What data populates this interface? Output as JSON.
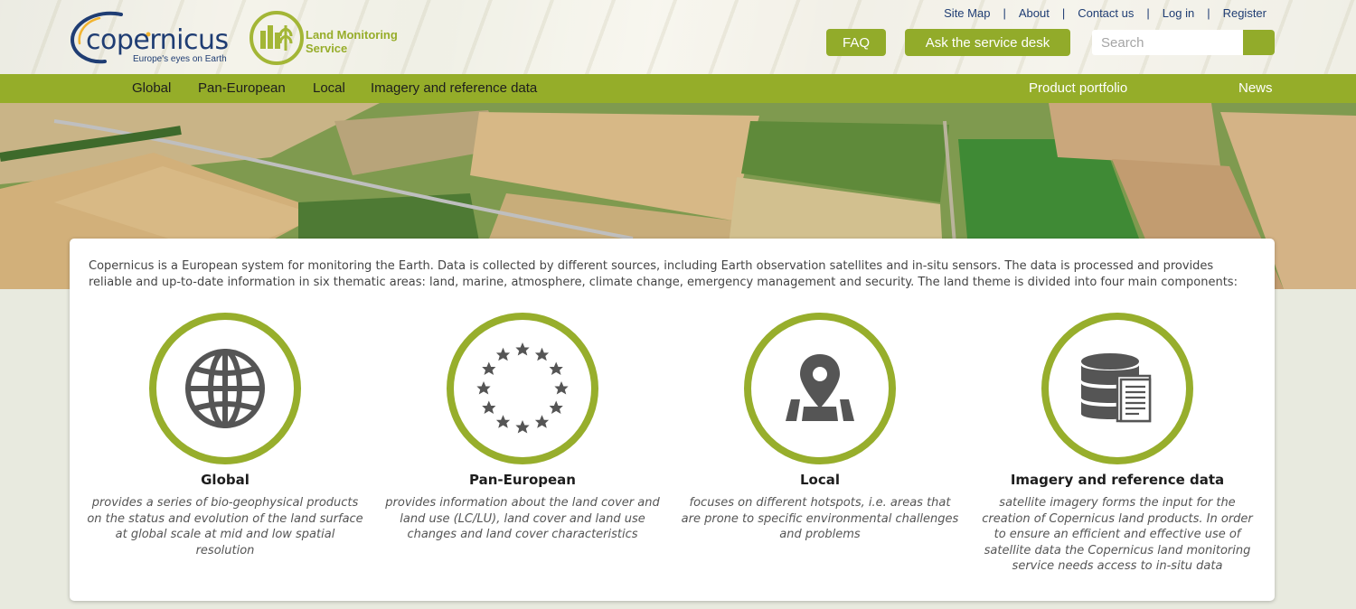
{
  "header": {
    "brand_name": "copernicus",
    "brand_tagline": "Europe's eyes on Earth",
    "service_name_line1": "Land Monitoring",
    "service_name_line2": "Service",
    "top_links": [
      "Site Map",
      "About",
      "Contact us",
      "Log in",
      "Register"
    ],
    "separator": "|",
    "faq_label": "FAQ",
    "service_desk_label": "Ask the service desk",
    "search_placeholder": "Search"
  },
  "nav": {
    "items": [
      "Global",
      "Pan-European",
      "Local",
      "Imagery and reference data"
    ],
    "right_items": [
      "Product portfolio",
      "News"
    ]
  },
  "intro_text": "Copernicus is a European system for monitoring the Earth. Data is collected by different sources, including Earth observation satellites and in-situ sensors. The data is processed and provides reliable and up-to-date information in six thematic areas: land, marine, atmosphere, climate change, emergency management and security. The land theme is divided into four main components:",
  "components": [
    {
      "title": "Global",
      "icon": "globe-icon",
      "description": "provides a series of bio-geophysical products on the status and evolution of the land surface at global scale at mid and low spatial resolution"
    },
    {
      "title": "Pan-European",
      "icon": "eu-stars-icon",
      "description": "provides information about the land cover and land use (LC/LU), land cover and land use changes and land cover characteristics"
    },
    {
      "title": "Local",
      "icon": "map-pin-icon",
      "description": "focuses on different hotspots, i.e. areas that are prone to specific environmental challenges and problems"
    },
    {
      "title": "Imagery and reference data",
      "icon": "database-document-icon",
      "description": "satellite imagery forms the input for the creation of Copernicus land products. In order to ensure an efficient and effective use of satellite data the Copernicus land monitoring service needs access to in-situ data"
    }
  ],
  "colors": {
    "accent_green": "#95ad29",
    "brand_blue": "#1f3d73",
    "icon_gray": "#555555"
  }
}
